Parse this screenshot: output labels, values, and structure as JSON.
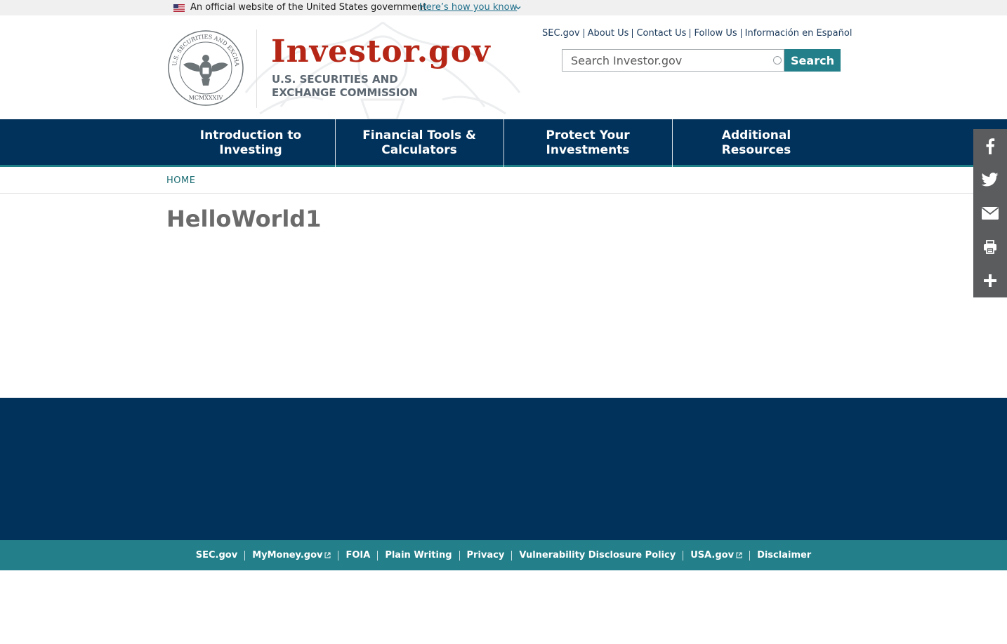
{
  "gov_banner": {
    "official_text": "An official website of the United States government",
    "how_you_know": "Here’s how you know"
  },
  "header": {
    "logo_title": "Investor.gov",
    "logo_subtitle_line1": "U.S. SECURITIES AND",
    "logo_subtitle_line2": "EXCHANGE COMMISSION",
    "seal_text": "U.S. SECURITIES AND EXCHANGE COMMISSION",
    "seal_year": "MCMXXXIV",
    "util_links": [
      "SEC.gov",
      "About Us",
      "Contact Us",
      "Follow Us",
      "Información en Español"
    ],
    "search_placeholder": "Search Investor.gov",
    "search_button": "Search"
  },
  "nav": {
    "items": [
      {
        "label": "Introduction to Investing"
      },
      {
        "label": "Financial Tools & Calculators"
      },
      {
        "label": "Protect Your Investments"
      },
      {
        "label": "Additional Resources"
      }
    ]
  },
  "breadcrumb": {
    "home": "HOME"
  },
  "main": {
    "title": "HelloWorld1"
  },
  "share": {
    "icons": [
      "facebook-icon",
      "twitter-icon",
      "email-icon",
      "print-icon",
      "plus-icon"
    ]
  },
  "footer": {
    "links": [
      {
        "label": "SEC.gov",
        "external": false
      },
      {
        "label": "MyMoney.gov",
        "external": true
      },
      {
        "label": "FOIA",
        "external": false
      },
      {
        "label": "Plain Writing",
        "external": false
      },
      {
        "label": "Privacy",
        "external": false
      },
      {
        "label": "Vulnerability Disclosure Policy",
        "external": false
      },
      {
        "label": "USA.gov",
        "external": true
      },
      {
        "label": "Disclaimer",
        "external": false
      }
    ]
  },
  "colors": {
    "navy": "#01325b",
    "teal": "#23808a",
    "brand_red": "#b52616"
  }
}
